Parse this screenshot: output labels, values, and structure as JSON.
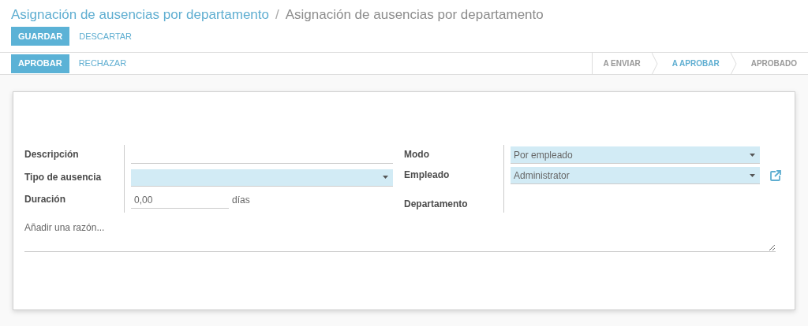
{
  "breadcrumb": [
    {
      "label": "Asignación de ausencias por departamento",
      "kind": "link"
    },
    {
      "label": "Asignación de ausencias por departamento",
      "kind": "current"
    }
  ],
  "breadcrumb_separator": "/",
  "edit_buttons": [
    {
      "label": "GUARDAR",
      "kind": "primary"
    },
    {
      "label": "DESCARTAR",
      "kind": "link"
    }
  ],
  "action_buttons": [
    {
      "label": "APROBAR",
      "kind": "primary"
    },
    {
      "label": "RECHAZAR",
      "kind": "link"
    }
  ],
  "stages": [
    {
      "label": "A ENVIAR",
      "selected": false
    },
    {
      "label": "A APROBAR",
      "selected": true
    },
    {
      "label": "APROBADO",
      "selected": false
    }
  ],
  "left_fields": [
    {
      "label": "Descripción",
      "kind": "text",
      "required": false
    },
    {
      "label": "Tipo de ausencia",
      "kind": "select",
      "required": true
    },
    {
      "label": "Duración",
      "kind": "number",
      "value": "0,00",
      "unit": "días",
      "required": false
    }
  ],
  "right_fields": [
    {
      "label": "Modo",
      "kind": "select",
      "value": "Por empleado",
      "required": true
    },
    {
      "label": "Empleado",
      "kind": "many2one",
      "value": "Administrator",
      "required": true
    },
    {
      "label": "Departamento",
      "kind": "empty"
    }
  ],
  "notes": {
    "placeholder": "Añadir una razón..."
  }
}
